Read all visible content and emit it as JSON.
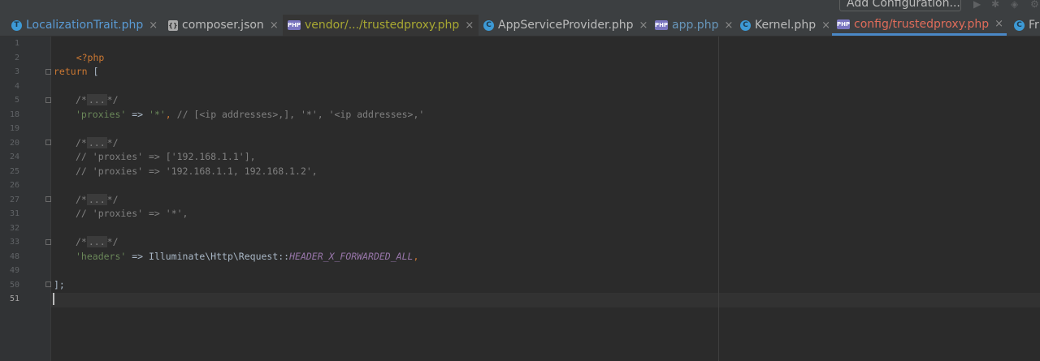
{
  "toolbar": {
    "add_configuration_label": "Add Configuration..."
  },
  "tabs": [
    {
      "label": "LocalizationTrait.php",
      "icon": "trait-icon",
      "close": "×"
    },
    {
      "label": "composer.json",
      "icon": "json-file-icon",
      "close": "×"
    },
    {
      "label": "vendor/.../trustedproxy.php",
      "icon": "php-file-icon",
      "close": "×"
    },
    {
      "label": "AppServiceProvider.php",
      "icon": "class-icon",
      "close": "×"
    },
    {
      "label": "app.php",
      "icon": "php-file-icon",
      "close": "×"
    },
    {
      "label": "Kernel.php",
      "icon": "class-icon",
      "close": "×"
    },
    {
      "label": "config/trustedproxy.php",
      "icon": "php-file-icon",
      "close": "×"
    },
    {
      "label": "Fr",
      "icon": "class-icon"
    }
  ],
  "tab_colors": {
    "default": "#bbbbbb",
    "trait": "#5a9bd5",
    "vendor": "#a8a832",
    "php": "#6897bb",
    "active": "#e06c5a",
    "accent": "#4a88c7"
  },
  "line_numbers": [
    "1",
    "2",
    "3",
    "4",
    "5",
    "18",
    "19",
    "20",
    "24",
    "25",
    "26",
    "27",
    "31",
    "32",
    "33",
    "48",
    "49",
    "50",
    "51"
  ],
  "code": {
    "l1": "<?php",
    "l3_kw": "return",
    "l3_rest": " [",
    "fold_open": "/*",
    "fold_dots": "...",
    "fold_close": "*/",
    "l18_key": "'proxies'",
    "l18_arrow": " => ",
    "l18_val": "'*'",
    "l18_comma": ",",
    "l18_comment": " // [<ip addresses>,], '*', '<ip addresses>,'",
    "l24": "// 'proxies' => ['192.168.1.1'],",
    "l25": "// 'proxies' => '192.168.1.1, 192.168.1.2',",
    "l31": "// 'proxies' => '*',",
    "l48_key": "'headers'",
    "l48_arrow": " => ",
    "l48_class": "Illuminate\\Http\\Request::",
    "l48_const": "HEADER_X_FORWARDED_ALL",
    "l48_comma": ",",
    "l50": "];"
  }
}
